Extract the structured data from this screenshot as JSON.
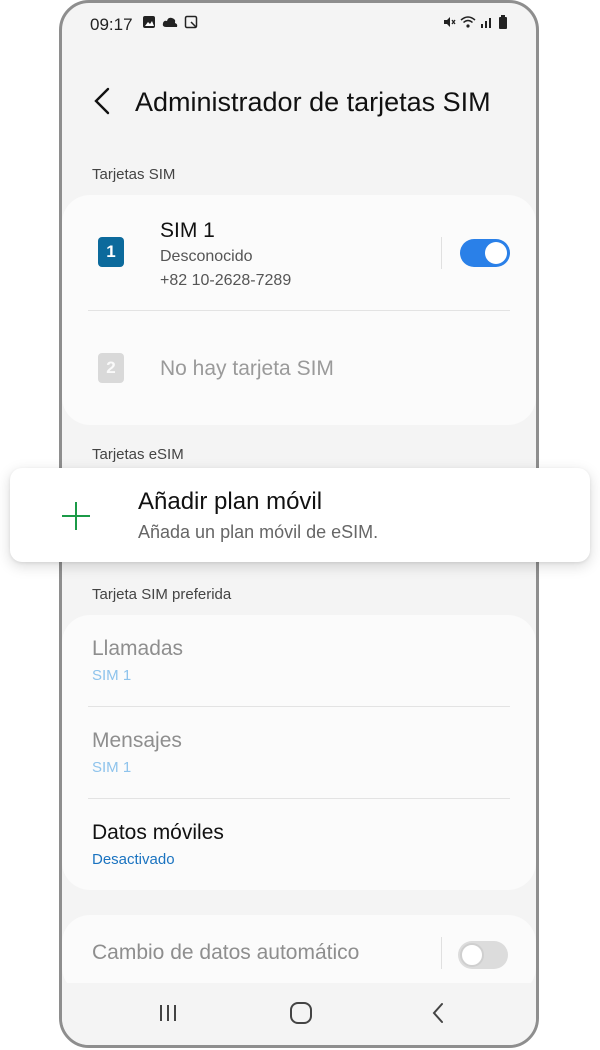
{
  "status_bar": {
    "time": "09:17",
    "left_icons": [
      "gallery-icon",
      "cloud-icon",
      "screenshot-icon"
    ],
    "right_icons": [
      "mute-icon",
      "wifi-icon",
      "signal-icon",
      "battery-icon"
    ]
  },
  "header": {
    "title": "Administrador de tarjetas SIM"
  },
  "sim_section": {
    "label": "Tarjetas SIM",
    "sim1": {
      "badge": "1",
      "title": "SIM 1",
      "carrier": "Desconocido",
      "number": "+82 10-2628-7289",
      "enabled": true
    },
    "sim2": {
      "badge": "2",
      "title": "No hay tarjeta SIM"
    }
  },
  "esim_section": {
    "label": "Tarjetas eSIM",
    "add_plan_title": "Añadir plan móvil",
    "add_plan_subtitle": "Añada un plan móvil de eSIM."
  },
  "preferred_section": {
    "label": "Tarjeta SIM preferida",
    "items": [
      {
        "title": "Llamadas",
        "value": "SIM 1"
      },
      {
        "title": "Mensajes",
        "value": "SIM 1"
      },
      {
        "title": "Datos móviles",
        "value": "Desactivado"
      }
    ]
  },
  "auto_switch": {
    "title": "Cambio de datos automático",
    "enabled": false
  },
  "colors": {
    "accent": "#2a80e8",
    "sim_badge": "#0c6a9c",
    "plus_green": "#1b9a47",
    "link_blue": "#1a73c0"
  }
}
